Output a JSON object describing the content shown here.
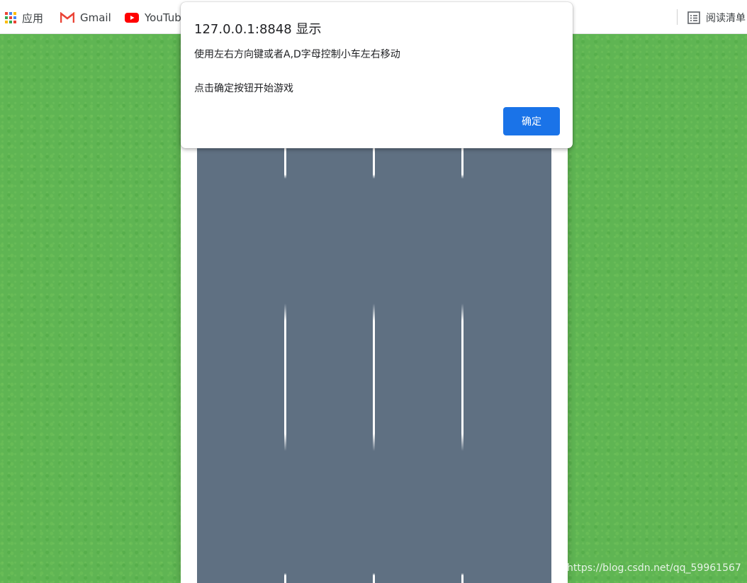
{
  "bookmarks": {
    "apps_label": "应用",
    "gmail_label": "Gmail",
    "youtube_label": "YouTube",
    "reading_list_label": "阅读清单"
  },
  "dialog": {
    "title": "127.0.0.1:8848 显示",
    "message_line1": "使用左右方向键或者A,D字母控制小车左右移动",
    "message_line2": "点击确定按钮开始游戏",
    "ok_label": "确定"
  },
  "colors": {
    "grass": "#5fb553",
    "road": "#5f7082",
    "lane_line": "#ffffff",
    "ok_button": "#1a73e8"
  },
  "watermark": "https://blog.csdn.net/qq_59961567"
}
